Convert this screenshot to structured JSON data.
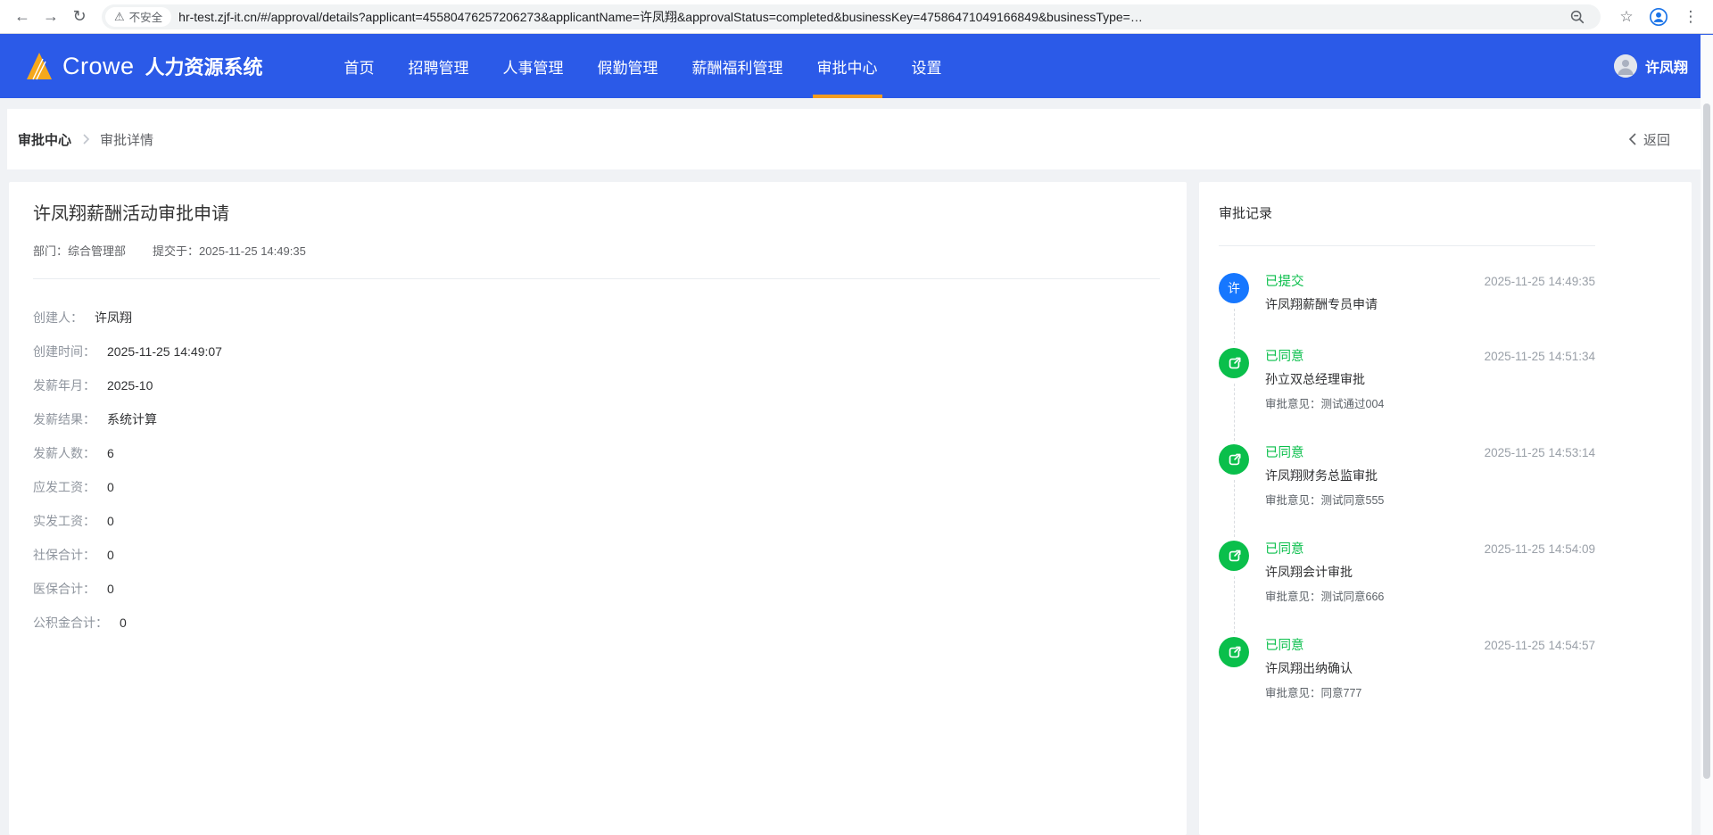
{
  "browser": {
    "security_label": "不安全",
    "url": "hr-test.zjf-it.cn/#/approval/details?applicant=45580476257206273&applicantName=许凤翔&approvalStatus=completed&businessKey=47586471049166849&businessType=…"
  },
  "header": {
    "brand": "Crowe",
    "product": "人力资源系统",
    "nav": [
      {
        "label": "首页"
      },
      {
        "label": "招聘管理"
      },
      {
        "label": "人事管理"
      },
      {
        "label": "假勤管理"
      },
      {
        "label": "薪酬福利管理"
      },
      {
        "label": "审批中心",
        "active": true
      },
      {
        "label": "设置"
      }
    ],
    "user": "许凤翔"
  },
  "breadcrumb": {
    "root": "审批中心",
    "current": "审批详情",
    "back_label": "返回"
  },
  "detail": {
    "title": "许凤翔薪酬活动审批申请",
    "meta": [
      {
        "label": "部门：",
        "value": "综合管理部"
      },
      {
        "label": "提交于：",
        "value": "2025-11-25 14:49:35"
      }
    ],
    "fields": [
      {
        "label": "创建人：",
        "value": "许凤翔"
      },
      {
        "label": "创建时间：",
        "value": "2025-11-25 14:49:07"
      },
      {
        "label": "发薪年月：",
        "value": "2025-10"
      },
      {
        "label": "发薪结果：",
        "value": "系统计算"
      },
      {
        "label": "发薪人数：",
        "value": "6"
      },
      {
        "label": "应发工资：",
        "value": "0"
      },
      {
        "label": "实发工资：",
        "value": "0"
      },
      {
        "label": "社保合计：",
        "value": "0"
      },
      {
        "label": "医保合计：",
        "value": "0"
      },
      {
        "label": "公积金合计：",
        "value": "0"
      }
    ]
  },
  "approval_log": {
    "title": "审批记录",
    "comment_label": "审批意见：",
    "entries": [
      {
        "status": "已提交",
        "name": "许凤翔薪酬专员申请",
        "time": "2025-11-25 14:49:35",
        "icon_text": "许",
        "comment": ""
      },
      {
        "status": "已同意",
        "name": "孙立双总经理审批",
        "time": "2025-11-25 14:51:34",
        "comment": "测试通过004"
      },
      {
        "status": "已同意",
        "name": "许凤翔财务总监审批",
        "time": "2025-11-25 14:53:14",
        "comment": "测试同意555"
      },
      {
        "status": "已同意",
        "name": "许凤翔会计审批",
        "time": "2025-11-25 14:54:09",
        "comment": "测试同意666"
      },
      {
        "status": "已同意",
        "name": "许凤翔出纳确认",
        "time": "2025-11-25 14:54:57",
        "comment": "同意777"
      }
    ]
  },
  "colors": {
    "header_blue": "#2b5ae8",
    "active_tab_orange": "#f39c1f",
    "logo_amber": "#f5a81c",
    "success_green": "#0abf4b",
    "submit_avatar_blue": "#1677ff",
    "page_background": "#f0f2f5"
  }
}
